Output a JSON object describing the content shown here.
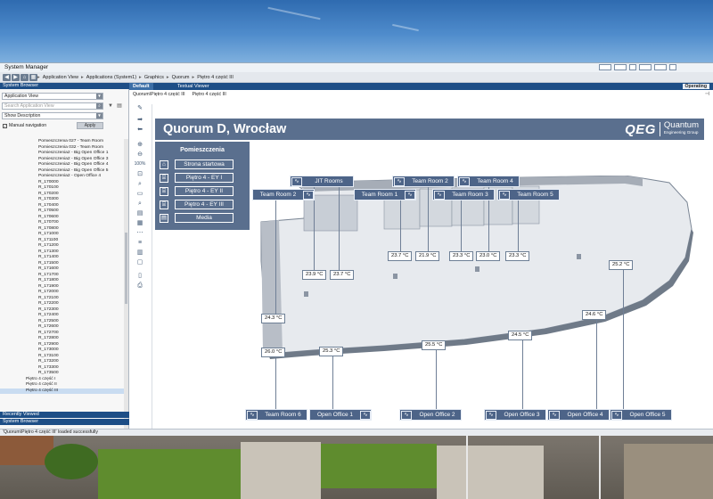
{
  "window": {
    "title": "System Manager"
  },
  "breadcrumb": [
    "Application View",
    "Applications (System1)",
    "Graphics",
    "Quorum",
    "Piętro 4 część III"
  ],
  "left_panel": {
    "header": "System Browser",
    "view_select": "Application View",
    "search_placeholder": "Search Application View",
    "show_select": "Show Description",
    "manual_navigation": "Manual navigation",
    "apply_label": "Apply",
    "tree_items": [
      "Pomieszczenia 027 - Team Room",
      "Pomieszczenia 032 - Team Room",
      "Pomieszczenia2 - Big Open Office 1",
      "Pomieszczenia2 - Big Open Office 3",
      "Pomieszczenia2 - Big Open Office 4",
      "Pomieszczenia2 - Big Open Office 5",
      "Pomieszczenia2 - Open Office 4",
      "R_170000",
      "R_170100",
      "R_170200",
      "R_170300",
      "R_170400",
      "R_170500",
      "R_170600",
      "R_170700",
      "R_170800",
      "R_171000",
      "R_171100",
      "R_171200",
      "R_171300",
      "R_171400",
      "R_171500",
      "R_171600",
      "R_171700",
      "R_171800",
      "R_171900",
      "R_172000",
      "R_172100",
      "R_172200",
      "R_172300",
      "R_172400",
      "R_172500",
      "R_172600",
      "R_172700",
      "R_172800",
      "R_172900",
      "R_173000",
      "R_173100",
      "R_173200",
      "R_173300",
      "R_173500",
      "Piętro 4 część I",
      "Piętro 4 część II",
      "Piętro 4 część III"
    ],
    "footer_1": "Recently Viewed",
    "footer_2": "System Browser"
  },
  "status_line": "'Quorum\\Piętro 4 część III' loaded successfully",
  "main": {
    "tab_default": "Default",
    "tab_textual": "Textual Viewer",
    "mode": "Operating",
    "path": [
      "Quorum\\Piętro 4 część III",
      "Piętro 4 część III"
    ]
  },
  "tools": {
    "zoom_level": "100%"
  },
  "graphic": {
    "banner_title": "Quorum D, Wrocław",
    "logo_mark": "QEG",
    "logo_name": "Quantum",
    "logo_sub": "Engineering Group",
    "menu_title": "Pomieszczenia",
    "menu_items": [
      "Strona startowa",
      "Piętro 4 - EY I",
      "Piętro 4 - EY II",
      "Piętro 4 - EY III",
      "Media"
    ],
    "rooms_top": [
      "Team Room 2",
      "JIT Rooms",
      "Team Room 1",
      "Team Room 2",
      "Team Room 3",
      "Team Room 4",
      "Team Room 5"
    ],
    "rooms_bottom": [
      "Team Room 6",
      "Open Office 1",
      "Open Office 2",
      "Open Office 3",
      "Open Office 4",
      "Open Office 5"
    ],
    "temps": {
      "t_jit_a": "23.9 °C",
      "t_jit_b": "23.7 °C",
      "t_tr1": "23.7 °C",
      "t_tr2": "21.9 °C",
      "t_tr3": "23.3 °C",
      "t_tr4": "23.0 °C",
      "t_tr5": "23.3 °C",
      "t_right": "25.2 °C",
      "t_oo4": "24.6 °C",
      "t_oo3": "24.5 °C",
      "t_oo2": "25.5 °C",
      "t_oo1": "25.3 °C",
      "t_tr6": "26.0 °C",
      "t_left": "24.3 °C"
    }
  },
  "colors": {
    "panel_blue": "#5a6f8e",
    "header_blue": "#1d4e86"
  }
}
